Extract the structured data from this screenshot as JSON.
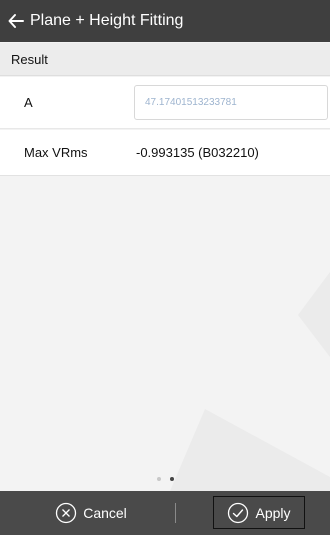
{
  "header": {
    "title": "Plane + Height Fitting",
    "back_icon": "arrow-left-icon"
  },
  "section": {
    "title": "Result"
  },
  "params": {
    "a_label": "A",
    "a_value": "47.17401513233781",
    "maxvrms_label": "Max VRms",
    "maxvrms_value": "-0.993135 (B032210)"
  },
  "pager": {
    "count": 2,
    "active_index": 1
  },
  "footer": {
    "cancel_label": "Cancel",
    "cancel_icon": "x-circle-icon",
    "apply_label": "Apply",
    "apply_icon": "check-circle-icon"
  },
  "colors": {
    "appbar": "#3f3f3f",
    "footer": "#4a4a4a",
    "input_text": "#9eb4cf"
  }
}
